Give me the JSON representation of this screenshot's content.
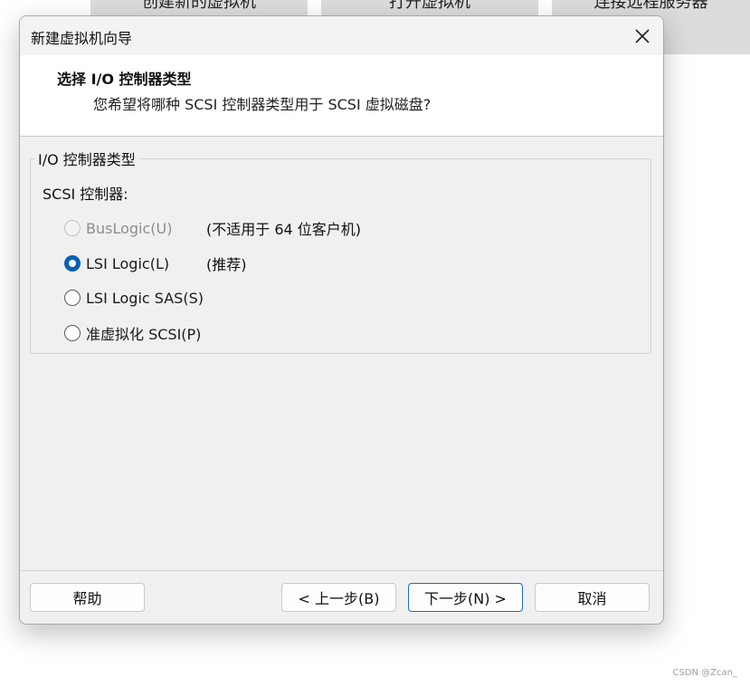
{
  "background": {
    "tiles": [
      "创建新的虚拟机",
      "打开虚拟机",
      "连接远程服务器"
    ]
  },
  "dialog": {
    "title": "新建虚拟机向导",
    "header": {
      "title": "选择 I/O 控制器类型",
      "subtitle": "您希望将哪种 SCSI 控制器类型用于 SCSI 虚拟磁盘?"
    },
    "group": {
      "legend": "I/O 控制器类型",
      "label": "SCSI 控制器:",
      "options": [
        {
          "label": "BusLogic(U)",
          "note": "(不适用于 64 位客户机)",
          "state": "disabled"
        },
        {
          "label": "LSI Logic(L)",
          "note": "(推荐)",
          "state": "checked"
        },
        {
          "label": "LSI Logic SAS(S)",
          "note": "",
          "state": "unchecked"
        },
        {
          "label": "准虚拟化 SCSI(P)",
          "note": "",
          "state": "unchecked"
        }
      ]
    },
    "buttons": {
      "help": "帮助",
      "back": "< 上一步(B)",
      "next": "下一步(N) >",
      "cancel": "取消"
    }
  },
  "watermark": "CSDN @Zcan_",
  "colors": {
    "accent": "#0a5fb4",
    "dialog_bg": "#f0f0f0",
    "header_bg": "#ffffff"
  }
}
